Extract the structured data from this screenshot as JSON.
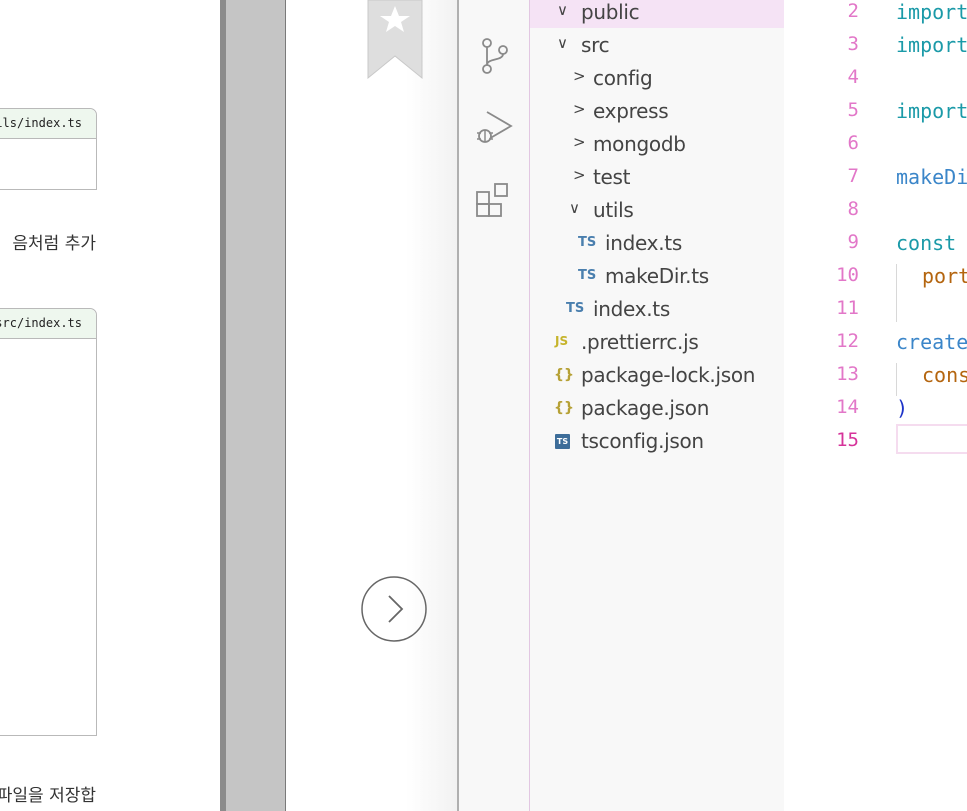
{
  "book": {
    "box1_header": "ils/index.ts",
    "box2_header": "src/index.ts",
    "line1": "음처럼 추가",
    "line2": "파일을 저장합"
  },
  "explorer": {
    "items": [
      {
        "chev": "∨",
        "label": "public"
      },
      {
        "chev": "∨",
        "label": "src"
      },
      {
        "chev": ">",
        "label": "config"
      },
      {
        "chev": ">",
        "label": "express"
      },
      {
        "chev": ">",
        "label": "mongodb"
      },
      {
        "chev": ">",
        "label": "test"
      },
      {
        "chev": "∨",
        "label": "utils"
      },
      {
        "icon": "TS",
        "label": "index.ts"
      },
      {
        "icon": "TS",
        "label": "makeDir.ts"
      },
      {
        "icon": "TS",
        "label": "index.ts"
      },
      {
        "icon": "JS",
        "label": ".prettierrc.js"
      },
      {
        "icon": "{}",
        "label": "package-lock.json"
      },
      {
        "icon": "{}",
        "label": "package.json"
      },
      {
        "icon": "TS",
        "label": "tsconfig.json"
      }
    ]
  },
  "editor": {
    "line_numbers": [
      "2",
      "3",
      "4",
      "5",
      "6",
      "7",
      "8",
      "9",
      "10",
      "11",
      "12",
      "13",
      "14",
      "15"
    ],
    "code": {
      "l2": "import",
      "l3": "import",
      "l5": "import",
      "l7": "makeDi",
      "l9": "const ",
      "l10": "port",
      "l12": "create",
      "l13": "cons",
      "l14": ")"
    }
  },
  "colors": {
    "line_number": "#e277c8",
    "active_line_number": "#d6339a",
    "keyword_teal": "#1b9aa8",
    "identifier_blue": "#3b86c9",
    "property_orange": "#b4650f",
    "selected_row": "#f5e3f5"
  }
}
